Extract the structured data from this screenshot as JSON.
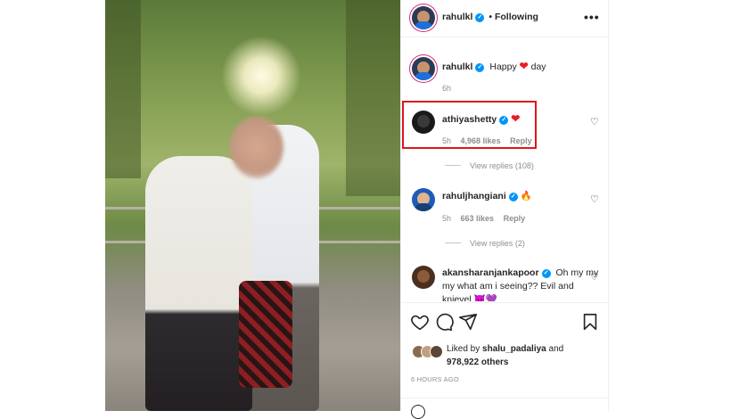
{
  "post": {
    "author": "rahulkl",
    "follow_state": "Following",
    "more_icon": "more-dots-icon"
  },
  "caption": {
    "username": "rahulkl",
    "text_before": "Happy",
    "emoji": "❤",
    "text_after": "day",
    "time": "6h"
  },
  "comments": [
    {
      "username": "athiyashetty",
      "text": "❤",
      "time": "5h",
      "likes": "4,968 likes",
      "reply": "Reply",
      "view_replies": "View replies (108)"
    },
    {
      "username": "rahuljhangiani",
      "text": "🔥",
      "time": "5h",
      "likes": "663 likes",
      "reply": "Reply",
      "view_replies": "View replies (2)"
    },
    {
      "username": "akansharanjankapoor",
      "text_line1": "Oh my my",
      "text_line2": "my what am i seeing?? Evil and",
      "text_line3": "knievel 😈💜"
    }
  ],
  "actions": {
    "like_icon": "heart-icon",
    "comment_icon": "comment-icon",
    "share_icon": "share-icon",
    "save_icon": "bookmark-icon"
  },
  "likes": {
    "liked_by_prefix": "Liked by",
    "liked_by_user": "shalu_padaliya",
    "and": "and",
    "others": "978,922 others"
  },
  "timestamp": "6 HOURS AGO",
  "colors": {
    "verified": "#0095f6",
    "highlight": "#e0161c",
    "heart": "#ed1c24"
  }
}
